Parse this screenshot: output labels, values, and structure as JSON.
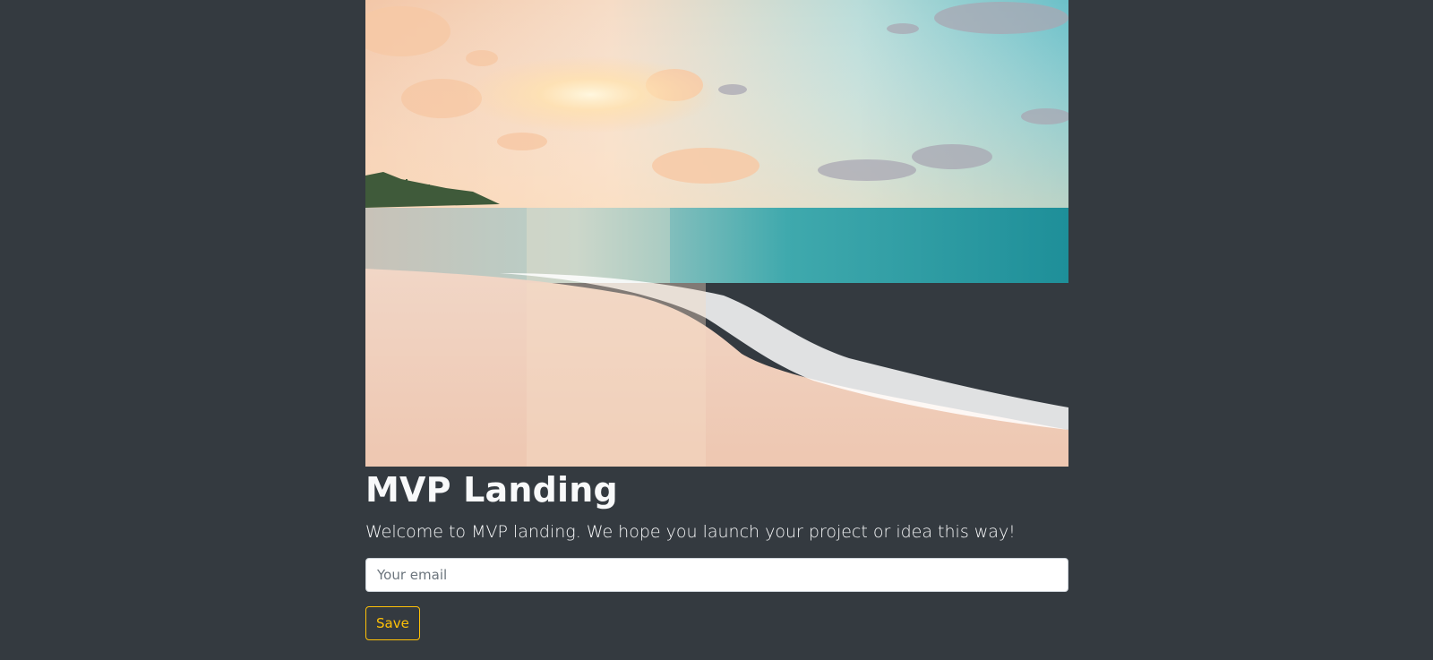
{
  "hero": {
    "image": "beach-sunset-photo"
  },
  "heading": {
    "title": "MVP Landing",
    "lead": "Welcome to MVP landing. We hope you launch your project or idea this way!"
  },
  "form": {
    "email_placeholder": "Your email",
    "email_value": "",
    "save_label": "Save"
  },
  "colors": {
    "page_background": "#343a40",
    "text": "#f8f9fa",
    "accent": "#ffc107"
  }
}
